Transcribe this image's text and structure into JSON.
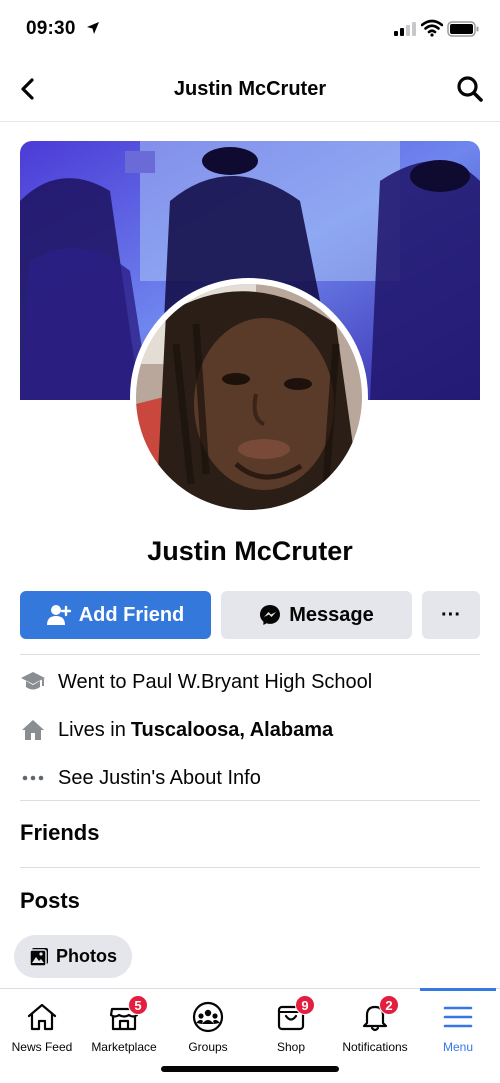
{
  "status_bar": {
    "time": "09:30"
  },
  "header": {
    "title": "Justin McCruter"
  },
  "profile": {
    "name": "Justin McCruter",
    "add_friend_label": "Add Friend",
    "message_label": "Message",
    "more_label": "···"
  },
  "about": {
    "education": "Went to Paul W.Bryant High School",
    "lives_prefix": "Lives in",
    "lives_place": "Tuscaloosa, Alabama",
    "see_about": "See Justin's About Info"
  },
  "sections": {
    "friends": "Friends",
    "posts": "Posts",
    "photos_chip": "Photos"
  },
  "tabbar": {
    "items": [
      {
        "label": "News Feed",
        "icon": "home-icon",
        "badge": ""
      },
      {
        "label": "Marketplace",
        "icon": "marketplace-icon",
        "badge": "5"
      },
      {
        "label": "Groups",
        "icon": "groups-icon",
        "badge": ""
      },
      {
        "label": "Shop",
        "icon": "shop-icon",
        "badge": "9"
      },
      {
        "label": "Notifications",
        "icon": "bell-icon",
        "badge": "2"
      },
      {
        "label": "Menu",
        "icon": "menu-icon",
        "badge": "",
        "active": true
      }
    ]
  },
  "colors": {
    "primary": "#3478db",
    "accent": "#3578e5",
    "badge": "#e41e3f",
    "button_gray": "#e4e6eb"
  }
}
